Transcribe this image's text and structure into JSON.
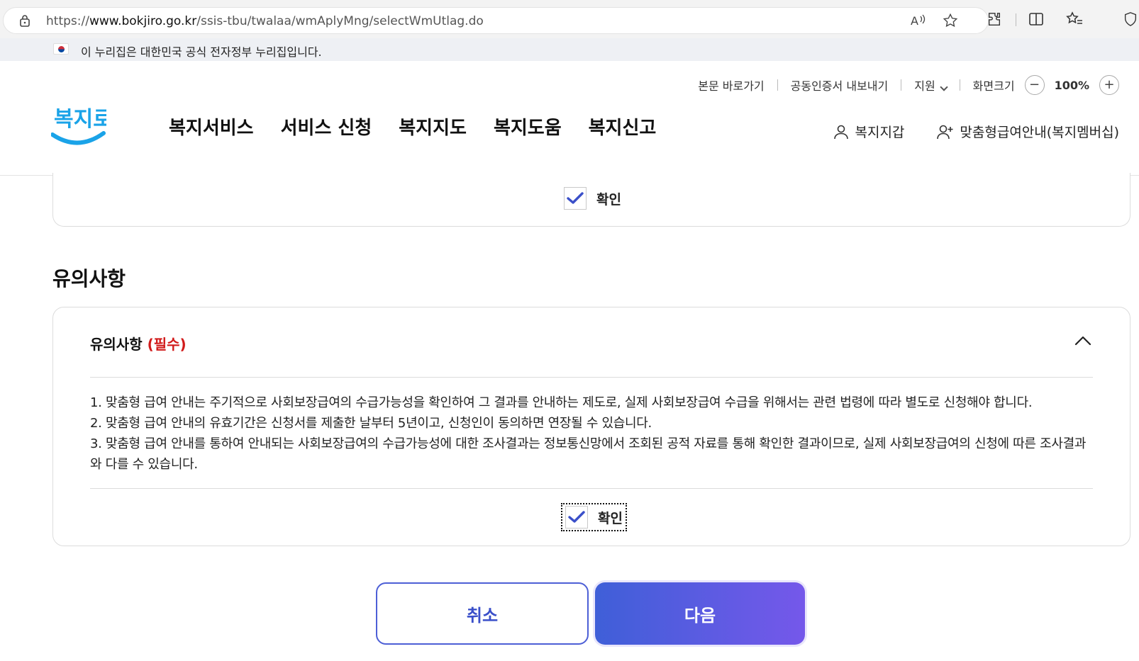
{
  "browser": {
    "url_prefix": "https://",
    "url_host": "www.bokjiro.go.kr",
    "url_path": "/ssis-tbu/twalaa/wmAplyMng/selectWmUtlag.do"
  },
  "gov_banner": {
    "text": "이 누리집은 대한민국 공식 전자정부 누리집입니다."
  },
  "header": {
    "logo_text": "복지로",
    "util": {
      "skip_main": "본문 바로가기",
      "export_cert": "공동인증서 내보내기",
      "support": "지원",
      "screen_size": "화면크기",
      "zoom_minus": "−",
      "zoom_value": "100%",
      "zoom_plus": "+"
    },
    "main_nav": [
      "복지서비스",
      "서비스 신청",
      "복지지도",
      "복지도움",
      "복지신고"
    ],
    "side_links": {
      "wallet": "복지지갑",
      "membership": "맞춤형급여안내(복지멤버십)"
    }
  },
  "top_card": {
    "confirm_label": "확인",
    "checked": true
  },
  "section_title": "유의사항",
  "notice": {
    "title": "유의사항",
    "required": "(필수)",
    "items": [
      "1. 맞춤형 급여 안내는 주기적으로 사회보장급여의 수급가능성을 확인하여 그 결과를 안내하는 제도로, 실제 사회보장급여 수급을 위해서는 관련 법령에 따라 별도로 신청해야 합니다.",
      "2. 맞춤형 급여 안내의 유효기간은 신청서를 제출한 날부터 5년이고, 신청인이 동의하면 연장될 수 있습니다.",
      "3. 맞춤형 급여 안내를 통하여 안내되는 사회보장급여의 수급가능성에 대한 조사결과는 정보통신망에서 조회된 공적 자료를 통해 확인한 결과이므로, 실제 사회보장급여의 신청에 따른 조사결과와 다를 수 있습니다."
    ],
    "confirm_label": "확인",
    "checked": true
  },
  "buttons": {
    "cancel": "취소",
    "next": "다음"
  },
  "colors": {
    "accent": "#4d5fd6",
    "required": "#d11a1a",
    "check": "#3a4fc9"
  }
}
